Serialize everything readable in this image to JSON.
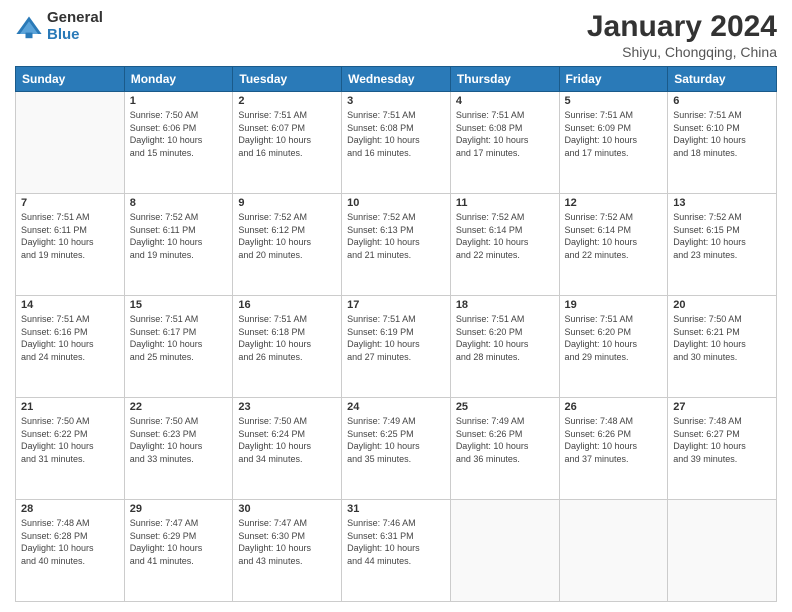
{
  "logo": {
    "general": "General",
    "blue": "Blue"
  },
  "title": "January 2024",
  "subtitle": "Shiyu, Chongqing, China",
  "days_header": [
    "Sunday",
    "Monday",
    "Tuesday",
    "Wednesday",
    "Thursday",
    "Friday",
    "Saturday"
  ],
  "weeks": [
    [
      {
        "day": "",
        "info": ""
      },
      {
        "day": "1",
        "info": "Sunrise: 7:50 AM\nSunset: 6:06 PM\nDaylight: 10 hours\nand 15 minutes."
      },
      {
        "day": "2",
        "info": "Sunrise: 7:51 AM\nSunset: 6:07 PM\nDaylight: 10 hours\nand 16 minutes."
      },
      {
        "day": "3",
        "info": "Sunrise: 7:51 AM\nSunset: 6:08 PM\nDaylight: 10 hours\nand 16 minutes."
      },
      {
        "day": "4",
        "info": "Sunrise: 7:51 AM\nSunset: 6:08 PM\nDaylight: 10 hours\nand 17 minutes."
      },
      {
        "day": "5",
        "info": "Sunrise: 7:51 AM\nSunset: 6:09 PM\nDaylight: 10 hours\nand 17 minutes."
      },
      {
        "day": "6",
        "info": "Sunrise: 7:51 AM\nSunset: 6:10 PM\nDaylight: 10 hours\nand 18 minutes."
      }
    ],
    [
      {
        "day": "7",
        "info": "Sunrise: 7:51 AM\nSunset: 6:11 PM\nDaylight: 10 hours\nand 19 minutes."
      },
      {
        "day": "8",
        "info": "Sunrise: 7:52 AM\nSunset: 6:11 PM\nDaylight: 10 hours\nand 19 minutes."
      },
      {
        "day": "9",
        "info": "Sunrise: 7:52 AM\nSunset: 6:12 PM\nDaylight: 10 hours\nand 20 minutes."
      },
      {
        "day": "10",
        "info": "Sunrise: 7:52 AM\nSunset: 6:13 PM\nDaylight: 10 hours\nand 21 minutes."
      },
      {
        "day": "11",
        "info": "Sunrise: 7:52 AM\nSunset: 6:14 PM\nDaylight: 10 hours\nand 22 minutes."
      },
      {
        "day": "12",
        "info": "Sunrise: 7:52 AM\nSunset: 6:14 PM\nDaylight: 10 hours\nand 22 minutes."
      },
      {
        "day": "13",
        "info": "Sunrise: 7:52 AM\nSunset: 6:15 PM\nDaylight: 10 hours\nand 23 minutes."
      }
    ],
    [
      {
        "day": "14",
        "info": "Sunrise: 7:51 AM\nSunset: 6:16 PM\nDaylight: 10 hours\nand 24 minutes."
      },
      {
        "day": "15",
        "info": "Sunrise: 7:51 AM\nSunset: 6:17 PM\nDaylight: 10 hours\nand 25 minutes."
      },
      {
        "day": "16",
        "info": "Sunrise: 7:51 AM\nSunset: 6:18 PM\nDaylight: 10 hours\nand 26 minutes."
      },
      {
        "day": "17",
        "info": "Sunrise: 7:51 AM\nSunset: 6:19 PM\nDaylight: 10 hours\nand 27 minutes."
      },
      {
        "day": "18",
        "info": "Sunrise: 7:51 AM\nSunset: 6:20 PM\nDaylight: 10 hours\nand 28 minutes."
      },
      {
        "day": "19",
        "info": "Sunrise: 7:51 AM\nSunset: 6:20 PM\nDaylight: 10 hours\nand 29 minutes."
      },
      {
        "day": "20",
        "info": "Sunrise: 7:50 AM\nSunset: 6:21 PM\nDaylight: 10 hours\nand 30 minutes."
      }
    ],
    [
      {
        "day": "21",
        "info": "Sunrise: 7:50 AM\nSunset: 6:22 PM\nDaylight: 10 hours\nand 31 minutes."
      },
      {
        "day": "22",
        "info": "Sunrise: 7:50 AM\nSunset: 6:23 PM\nDaylight: 10 hours\nand 33 minutes."
      },
      {
        "day": "23",
        "info": "Sunrise: 7:50 AM\nSunset: 6:24 PM\nDaylight: 10 hours\nand 34 minutes."
      },
      {
        "day": "24",
        "info": "Sunrise: 7:49 AM\nSunset: 6:25 PM\nDaylight: 10 hours\nand 35 minutes."
      },
      {
        "day": "25",
        "info": "Sunrise: 7:49 AM\nSunset: 6:26 PM\nDaylight: 10 hours\nand 36 minutes."
      },
      {
        "day": "26",
        "info": "Sunrise: 7:48 AM\nSunset: 6:26 PM\nDaylight: 10 hours\nand 37 minutes."
      },
      {
        "day": "27",
        "info": "Sunrise: 7:48 AM\nSunset: 6:27 PM\nDaylight: 10 hours\nand 39 minutes."
      }
    ],
    [
      {
        "day": "28",
        "info": "Sunrise: 7:48 AM\nSunset: 6:28 PM\nDaylight: 10 hours\nand 40 minutes."
      },
      {
        "day": "29",
        "info": "Sunrise: 7:47 AM\nSunset: 6:29 PM\nDaylight: 10 hours\nand 41 minutes."
      },
      {
        "day": "30",
        "info": "Sunrise: 7:47 AM\nSunset: 6:30 PM\nDaylight: 10 hours\nand 43 minutes."
      },
      {
        "day": "31",
        "info": "Sunrise: 7:46 AM\nSunset: 6:31 PM\nDaylight: 10 hours\nand 44 minutes."
      },
      {
        "day": "",
        "info": ""
      },
      {
        "day": "",
        "info": ""
      },
      {
        "day": "",
        "info": ""
      }
    ]
  ]
}
